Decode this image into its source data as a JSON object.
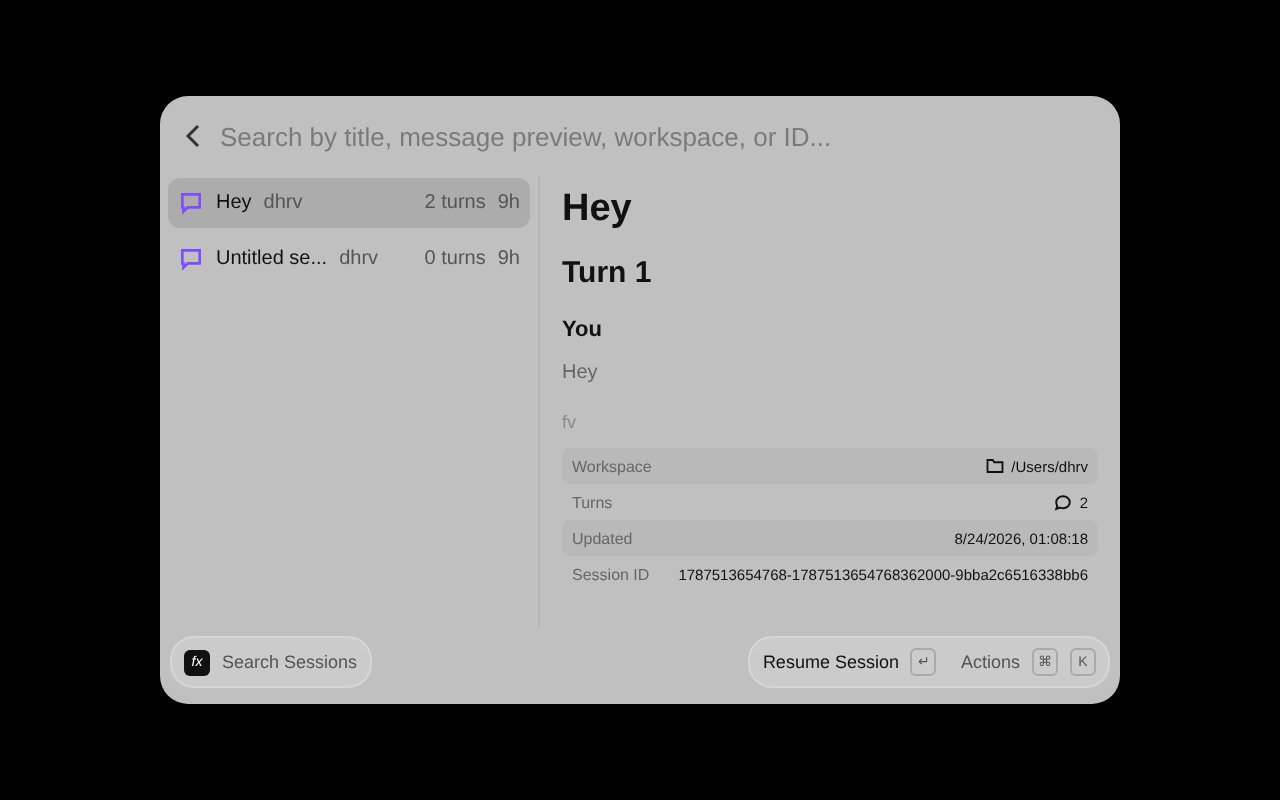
{
  "search": {
    "placeholder": "Search by title, message preview, workspace, or ID..."
  },
  "sessions": [
    {
      "title": "Hey",
      "user": "dhrv",
      "turns": "2 turns",
      "age": "9h",
      "selected": true
    },
    {
      "title": "Untitled se...",
      "user": "dhrv",
      "turns": "0 turns",
      "age": "9h",
      "selected": false
    }
  ],
  "detail": {
    "title": "Hey",
    "turn": "Turn 1",
    "speaker": "You",
    "message": "Hey",
    "faint": "fv",
    "meta": [
      {
        "kind": "folder",
        "label": "Workspace",
        "value": "/Users/dhrv"
      },
      {
        "kind": "chat",
        "label": "Turns",
        "value": "2"
      },
      {
        "kind": "plain",
        "label": "Updated",
        "value": "8/24/2026, 01:08:18"
      },
      {
        "kind": "plain",
        "label": "Session ID",
        "value": "1787513654768-1787513654768362000-9bba2c6516338bb6"
      }
    ]
  },
  "footer": {
    "logo": "fx",
    "search_label": "Search Sessions",
    "resume_label": "Resume Session",
    "resume_key": "↵",
    "actions_label": "Actions",
    "action_keys": [
      "⌘",
      "K"
    ]
  }
}
